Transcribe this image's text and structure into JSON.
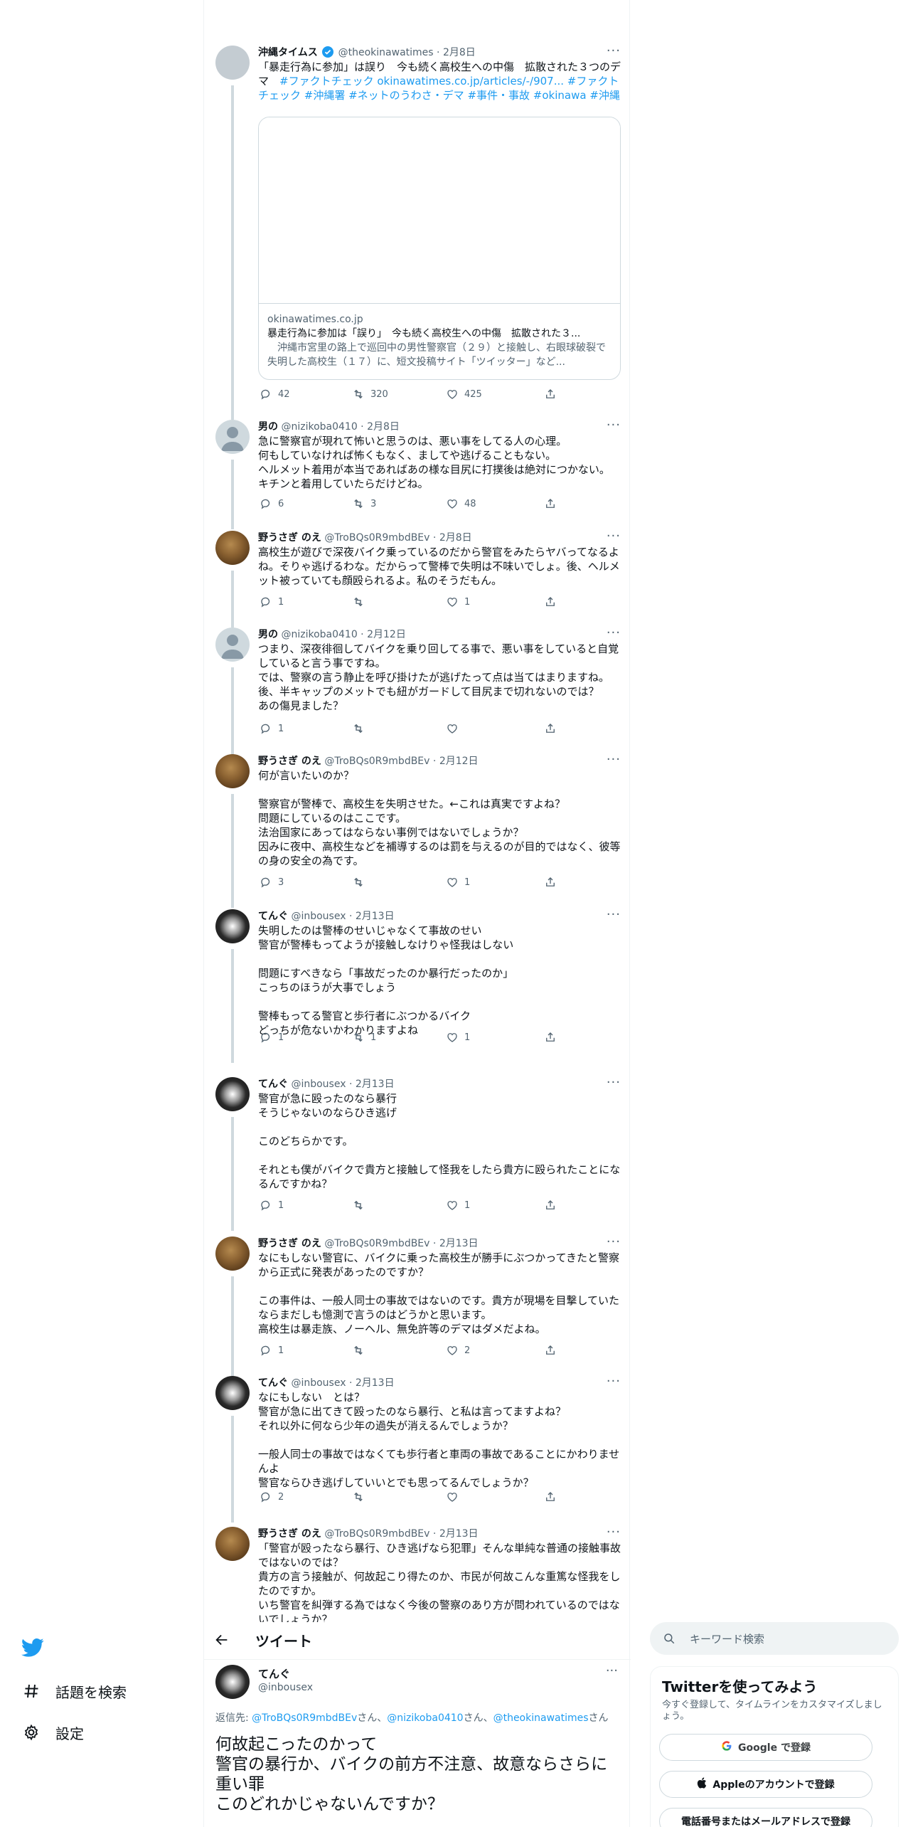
{
  "thread": [
    {
      "name": "沖縄タイムス",
      "verified": true,
      "handle": "@theokinawatimes",
      "date": "2月8日",
      "text_plain": "「暴走行為に参加」は誤り　今も続く高校生への中傷　拡散された３つのデマ　",
      "text_links": "#ファクトチェック okinawatimes.co.jp/articles/-/907... #ファクトチェック #沖縄署 #ネットのうわさ・デマ #事件・事故 #okinawa #沖縄",
      "card": {
        "domain": "okinawatimes.co.jp",
        "title": "暴走行為に参加は「誤り」　今も続く高校生への中傷　拡散された３...",
        "desc": "　沖縄市宮里の路上で巡回中の男性警察官（２９）と接触し、右眼球破裂で失明した高校生（１７）に、短文投稿サイト「ツイッター」など..."
      },
      "replies": "42",
      "retweets": "320",
      "likes": "425"
    },
    {
      "name": "男の",
      "handle": "@nizikoba0410",
      "date": "2月8日",
      "text": "急に警察官が現れて怖いと思うのは、悪い事をしてる人の心理。\n何もしていなければ怖くもなく、ましてや逃げることもない。\nヘルメット着用が本当であればあの様な目尻に打撲後は絶対につかない。\nキチンと着用していたらだけどね。",
      "replies": "6",
      "retweets": "3",
      "likes": "48"
    },
    {
      "name": "野うさぎ のえ",
      "handle": "@TroBQs0R9mbdBEv",
      "date": "2月8日",
      "text": "高校生が遊びで深夜バイク乗っているのだから警官をみたらヤバってなるよね。そりゃ逃げるわな。だからって警棒で失明は不味いでしょ。後、ヘルメット被っていても顔殴られるよ。私のそうだもん。",
      "replies": "1",
      "retweets": "",
      "likes": "1"
    },
    {
      "name": "男の",
      "handle": "@nizikoba0410",
      "date": "2月12日",
      "text": "つまり、深夜徘徊してバイクを乗り回してる事で、悪い事をしていると自覚していると言う事ですね。\nでは、警察の言う静止を呼び掛けたが逃げたって点は当てはまりますね。\n後、半キャップのメットでも紐がガードして目尻まで切れないのでは？\nあの傷見ました？",
      "replies": "1",
      "retweets": "",
      "likes": ""
    },
    {
      "name": "野うさぎ のえ",
      "handle": "@TroBQs0R9mbdBEv",
      "date": "2月12日",
      "text": "何が言いたいのか？\n\n警察官が警棒で、高校生を失明させた。←これは真実ですよね？\n問題にしているのはここです。\n法治国家にあってはならない事例ではないでしょうか？\n因みに夜中、高校生などを補導するのは罰を与えるのが目的ではなく、彼等の身の安全の為です。",
      "replies": "3",
      "retweets": "",
      "likes": "1"
    },
    {
      "name": "てんぐ",
      "handle": "@inbousex",
      "date": "2月13日",
      "text": "失明したのは警棒のせいじゃなくて事故のせい\n警官が警棒もってようが接触しなけりゃ怪我はしない\n\n問題にすべきなら「事故だったのか暴行だったのか」\nこっちのほうが大事でしょう\n\n警棒もってる警官と歩行者にぶつかるバイク\nどっちが危ないかわかりますよね",
      "replies": "1",
      "retweets": "1",
      "likes": "1"
    },
    {
      "name": "てんぐ",
      "handle": "@inbousex",
      "date": "2月13日",
      "text": "警官が急に殴ったのなら暴行\nそうじゃないのならひき逃げ\n\nこのどちらかです。\n\nそれとも僕がバイクで貴方と接触して怪我をしたら貴方に殴られたことになるんですかね？",
      "replies": "1",
      "retweets": "",
      "likes": "1"
    },
    {
      "name": "野うさぎ のえ",
      "handle": "@TroBQs0R9mbdBEv",
      "date": "2月13日",
      "text": "なにもしない警官に、バイクに乗った高校生が勝手にぶつかってきたと警察から正式に発表があったのですか？\n\nこの事件は、一般人同士の事故ではないのです。貴方が現場を目撃していたならまだしも憶測で言うのはどうかと思います。\n高校生は暴走族、ノーヘル、無免許等のデマはダメだよね。",
      "replies": "1",
      "retweets": "",
      "likes": "2"
    },
    {
      "name": "てんぐ",
      "handle": "@inbousex",
      "date": "2月13日",
      "text": "なにもしない　とは？\n警官が急に出てきて殴ったのなら暴行、と私は言ってますよね？\nそれ以外に何なら少年の過失が消えるんでしょうか？\n\n一般人同士の事故ではなくても歩行者と車両の事故であることにかわりませんよ\n警官ならひき逃げしていいとでも思ってるんでしょうか？",
      "replies": "2",
      "retweets": "",
      "likes": ""
    },
    {
      "name": "野うさぎ のえ",
      "handle": "@TroBQs0R9mbdBEv",
      "date": "2月13日",
      "text": "「警官が殴ったなら暴行、ひき逃げなら犯罪」そんな単純な普通の接触事故ではないのでは？\n貴方の言う接触が、何故起こり得たのか、市民が何故こんな重篤な怪我をしたのですか。\nいち警官を糾弾する為ではなく今後の警察のあり方が問われているのではないでしょうか？",
      "replies": "",
      "retweets": "",
      "likes": ""
    }
  ],
  "nav": {
    "explore": "話題を検索",
    "settings": "設定"
  },
  "main": {
    "header_title": "ツイート",
    "name": "てんぐ",
    "handle": "@inbousex",
    "reply_prefix": "返信先: ",
    "reply_to_1": "@TroBQs0R9mbdBEv",
    "reply_sep_1": "さん、",
    "reply_to_2": "@nizikoba0410",
    "reply_sep_2": "さん、",
    "reply_to_3": "@theokinawatimes",
    "reply_suffix": "さん",
    "text": "何故起こったのかって\n警官の暴行か、バイクの前方不注意、故意ならさらに重い罪\nこのどれかじゃないんですか？"
  },
  "sidebar": {
    "search_placeholder": "キーワード検索",
    "try_title": "Twitterを使ってみよう",
    "try_sub": "今すぐ登録して、タイムラインをカスタマイズしましょう。",
    "google_btn": "Google で登録",
    "apple_btn": "Appleのアカウントで登録",
    "phone_btn": "電話番号またはメールアドレスで登録"
  },
  "colors": {
    "accent": "#1d9bf0",
    "text": "#0f1419",
    "muted": "#536471"
  }
}
